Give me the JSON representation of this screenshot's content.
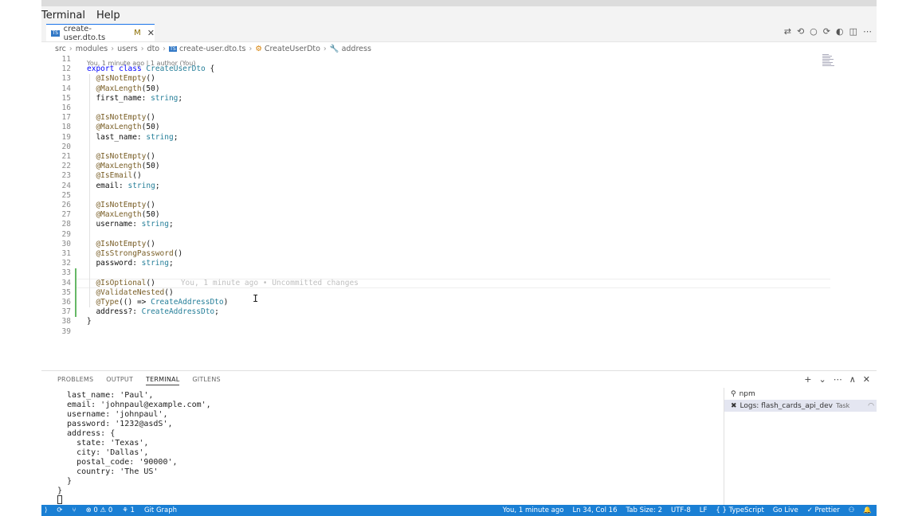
{
  "menu": [
    "Terminal",
    "Help"
  ],
  "tab": {
    "filename": "create-user.dto.ts",
    "modified": "M",
    "close": "✕"
  },
  "tab_actions": [
    "⇄",
    "⟲",
    "○",
    "⟳",
    "◐",
    "◫",
    "⋯"
  ],
  "breadcrumb": [
    "src",
    "modules",
    "users",
    "dto",
    "create-user.dto.ts",
    "CreateUserDto",
    "address"
  ],
  "editor": {
    "blame_header": "You, 1 minute ago | 1 author (You)",
    "inline_blame": "You, 1 minute ago • Uncommitted changes",
    "lines": [
      {
        "n": "11",
        "t": ""
      },
      {
        "n": "12",
        "t": "export class CreateUserDto {"
      },
      {
        "n": "13",
        "t": "  @IsNotEmpty()"
      },
      {
        "n": "14",
        "t": "  @MaxLength(50)"
      },
      {
        "n": "15",
        "t": "  first_name: string;"
      },
      {
        "n": "16",
        "t": ""
      },
      {
        "n": "17",
        "t": "  @IsNotEmpty()"
      },
      {
        "n": "18",
        "t": "  @MaxLength(50)"
      },
      {
        "n": "19",
        "t": "  last_name: string;"
      },
      {
        "n": "20",
        "t": ""
      },
      {
        "n": "21",
        "t": "  @IsNotEmpty()"
      },
      {
        "n": "22",
        "t": "  @MaxLength(50)"
      },
      {
        "n": "23",
        "t": "  @IsEmail()"
      },
      {
        "n": "24",
        "t": "  email: string;"
      },
      {
        "n": "25",
        "t": ""
      },
      {
        "n": "26",
        "t": "  @IsNotEmpty()"
      },
      {
        "n": "27",
        "t": "  @MaxLength(50)"
      },
      {
        "n": "28",
        "t": "  username: string;"
      },
      {
        "n": "29",
        "t": ""
      },
      {
        "n": "30",
        "t": "  @IsNotEmpty()"
      },
      {
        "n": "31",
        "t": "  @IsStrongPassword()"
      },
      {
        "n": "32",
        "t": "  password: string;"
      },
      {
        "n": "33",
        "t": ""
      },
      {
        "n": "34",
        "t": "  @IsOptional()"
      },
      {
        "n": "35",
        "t": "  @ValidateNested()"
      },
      {
        "n": "36",
        "t": "  @Type(() => CreateAddressDto)"
      },
      {
        "n": "37",
        "t": "  address?: CreateAddressDto;"
      },
      {
        "n": "38",
        "t": "}"
      },
      {
        "n": "39",
        "t": ""
      }
    ]
  },
  "panel": {
    "tabs": [
      "PROBLEMS",
      "OUTPUT",
      "TERMINAL",
      "GITLENS"
    ],
    "active_tab": "TERMINAL",
    "actions": [
      "+",
      "⌄",
      "⋯",
      "∧",
      "✕"
    ],
    "terminal_output": "  last_name: 'Paul',\n  email: 'johnpaul@example.com',\n  username: 'johnpaul',\n  password: '1232@asdS',\n  address: {\n    state: 'Texas',\n    city: 'Dallas',\n    postal_code: '90000',\n    country: 'The US'\n  }\n}",
    "terminal_list": [
      {
        "label": "npm",
        "task": ""
      },
      {
        "label": "Logs: flash_cards_api_dev",
        "task": "Task"
      }
    ]
  },
  "statusbar": {
    "left": [
      "⊗ 0 ⚠ 0",
      "⚘ 1",
      "Git Graph"
    ],
    "right": [
      "You, 1 minute ago",
      "Ln 34, Col 16",
      "Tab Size: 2",
      "UTF-8",
      "LF",
      "{ } TypeScript",
      "Go Live",
      "✓ Prettier"
    ]
  }
}
